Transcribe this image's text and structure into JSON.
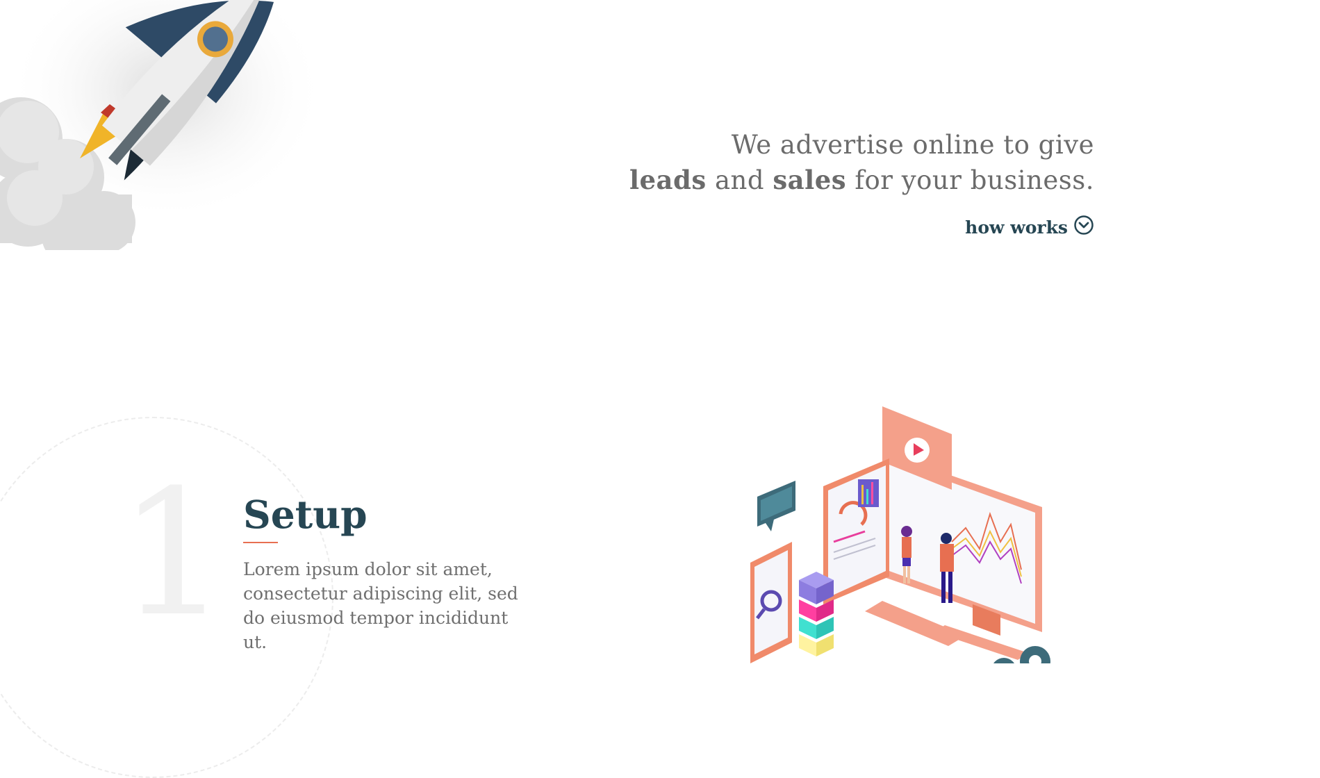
{
  "hero": {
    "line1": "We advertise online to give",
    "line2_parts": {
      "bold1": "leads",
      "mid": " and ",
      "bold2": "sales",
      "end": " for your business."
    },
    "link_label": "how works",
    "link_icon": "chevron-down-circle-icon"
  },
  "step": {
    "number": "1",
    "title": "Setup",
    "description": "Lorem ipsum dolor sit amet, consectetur adipiscing elit, sed do eiusmod tempor incididunt ut."
  },
  "colors": {
    "primary": "#264653",
    "accent": "#e76f51",
    "text": "#6b6b6b",
    "coral": "#f4a08a"
  }
}
